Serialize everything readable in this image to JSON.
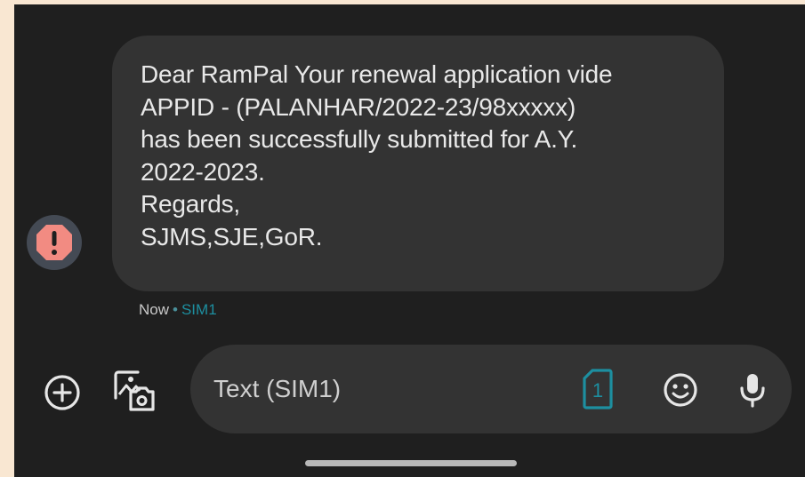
{
  "message": {
    "lines": [
      "Dear RamPal Your renewal application vide",
      "APPID - (PALANHAR/2022-23/98xxxxx)",
      "has been successfully submitted for A.Y.",
      "2022-2023.",
      "Regards,",
      "SJMS,SJE,GoR."
    ],
    "time": "Now",
    "separator": "•",
    "sim": "SIM1"
  },
  "avatar": {
    "icon": "warning-octagon-icon",
    "color": "#f28b82"
  },
  "compose": {
    "placeholder": "Text (SIM1)",
    "sim_badge": "1"
  },
  "icons": {
    "add": "plus-circle-icon",
    "media": "gallery-camera-icon",
    "emoji": "emoji-icon",
    "mic": "microphone-icon"
  },
  "colors": {
    "background": "#1f1f1f",
    "bubble": "#333333",
    "accent": "#1d8fa0",
    "warning": "#f28b82",
    "frame": "#f9e7d2"
  }
}
